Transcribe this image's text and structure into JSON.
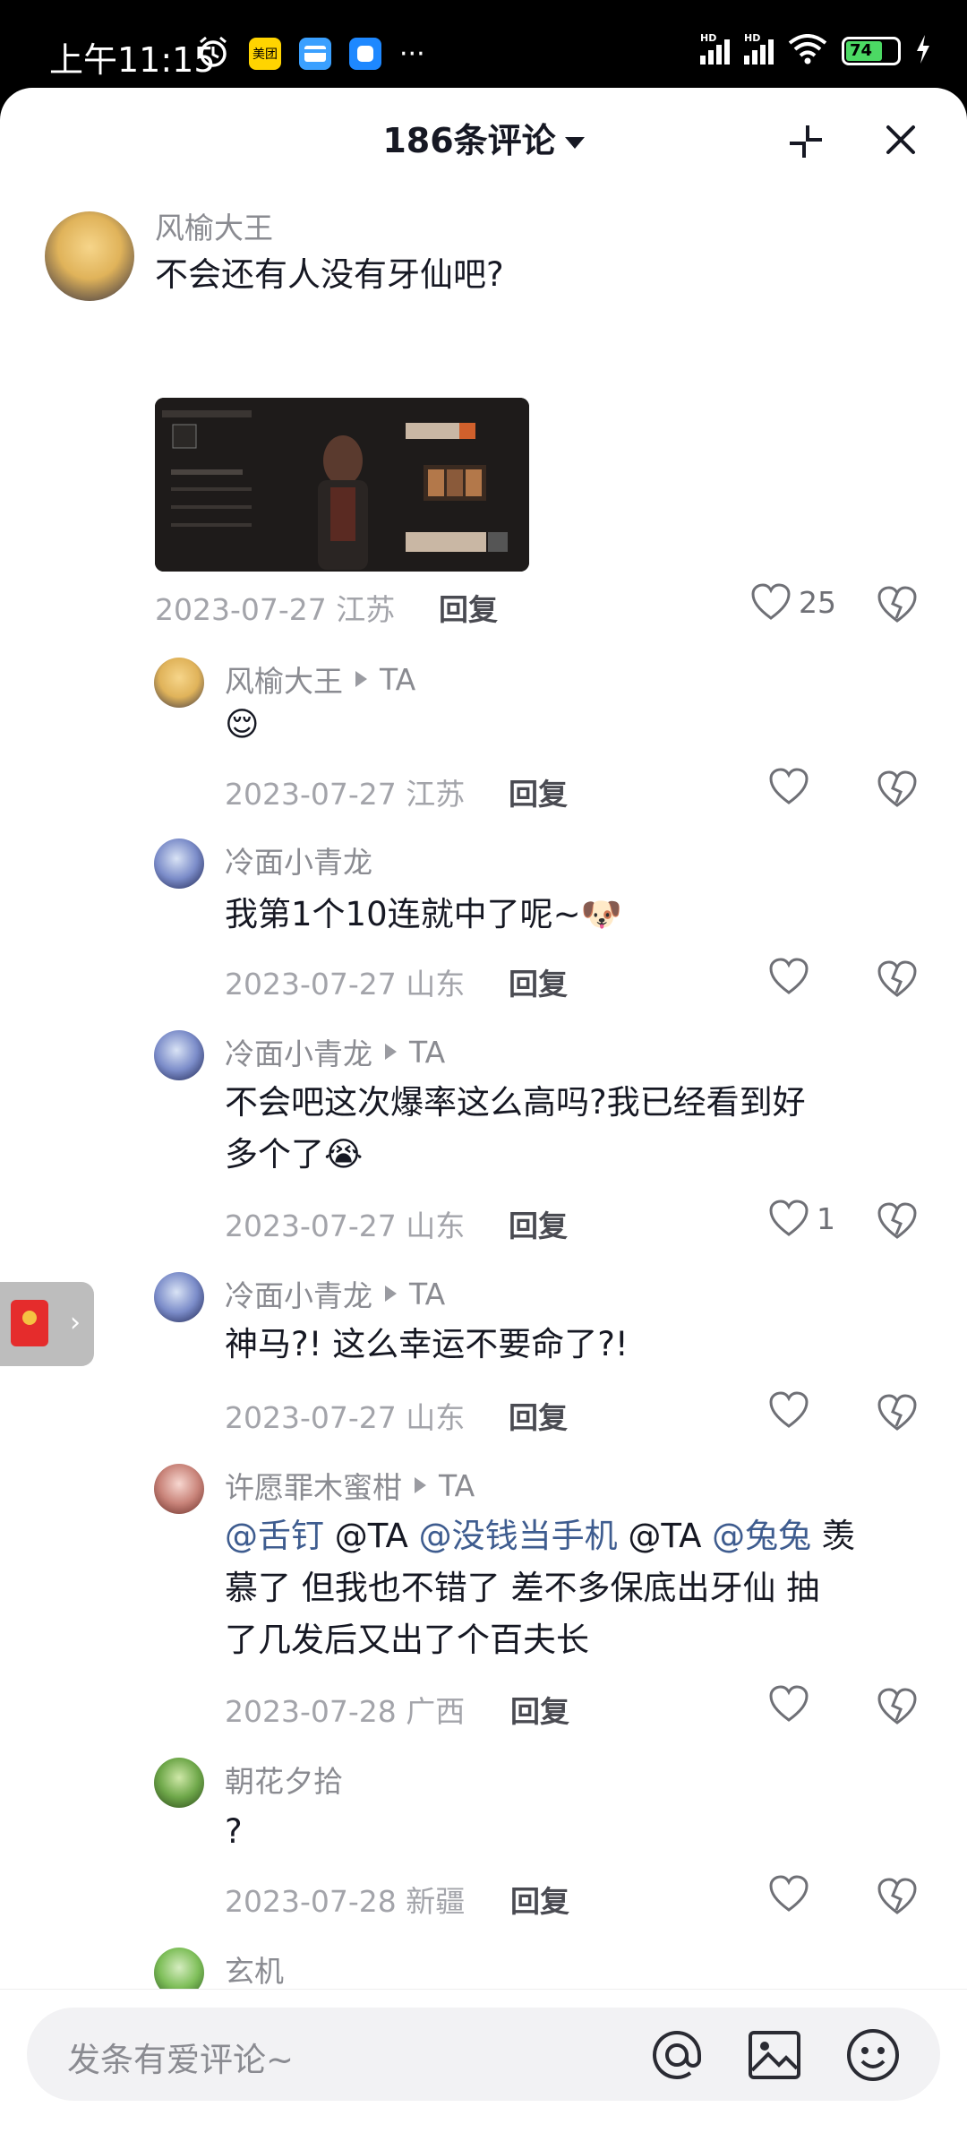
{
  "status": {
    "time": "上午11:15",
    "battery": "74",
    "app_badge": "美团",
    "more": "···",
    "hd": "HD"
  },
  "header": {
    "title": "186条评论"
  },
  "comments": [
    {
      "nick": "风榆大王",
      "text": "不会还有人没有牙仙吧?",
      "date": "2023-07-27 江苏",
      "reply": "回复",
      "likes": "25"
    },
    {
      "nick": "风榆大王",
      "tag": "TA",
      "text": "😌",
      "date": "2023-07-27 江苏",
      "reply": "回复",
      "likes": ""
    },
    {
      "nick": "冷面小青龙",
      "text": "我第1个10连就中了呢~🐶",
      "date": "2023-07-27 山东",
      "reply": "回复",
      "likes": ""
    },
    {
      "nick": "冷面小青龙",
      "tag": "TA",
      "text_line1": "不会吧这次爆率这么高吗?我已经看到好",
      "text_line2": "多个了😭",
      "date": "2023-07-27 山东",
      "reply": "回复",
      "likes": "1"
    },
    {
      "nick": "冷面小青龙",
      "tag": "TA",
      "text": "神马?! 这么幸运不要命了?!",
      "date": "2023-07-27 山东",
      "reply": "回复",
      "likes": ""
    },
    {
      "nick": "许愿罪木蜜柑",
      "tag": "TA",
      "mentions": [
        "@舌钉",
        "@TA",
        "@没钱当手机",
        "@TA",
        "@兔兔"
      ],
      "text_line1_tail": "羡",
      "text_line2": "慕了 但我也不错了 差不多保底出牙仙 抽",
      "text_line3": "了几发后又出了个百夫长",
      "date": "2023-07-28 广西",
      "reply": "回复",
      "likes": ""
    },
    {
      "nick": "朝花夕拾",
      "text": "?",
      "date": "2023-07-28 新疆",
      "reply": "回复",
      "likes": ""
    },
    {
      "nick": "玄机"
    }
  ],
  "input": {
    "placeholder": "发条有爱评论~"
  }
}
